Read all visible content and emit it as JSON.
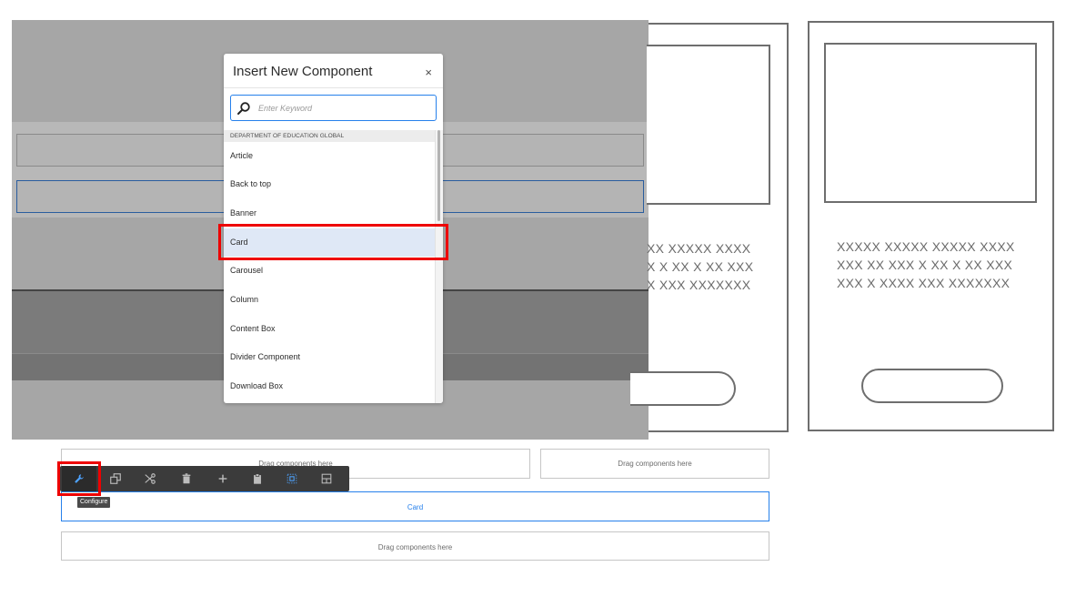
{
  "modal": {
    "title": "Insert New Component",
    "close_glyph": "×",
    "search_placeholder": "Enter Keyword",
    "group_header": "DEPARTMENT OF EDUCATION GLOBAL",
    "items": [
      "Article",
      "Back to top",
      "Banner",
      "Card",
      "Carousel",
      "Column",
      "Content Box",
      "Divider Component",
      "Download Box"
    ],
    "selected_item": "Card"
  },
  "wireframe": {
    "card_left_text": [
      "XX XXXXX XXXX",
      "X X XX X XX XXX",
      "X XXX XXXXXXX"
    ],
    "card_right_text": [
      "XXXXX XXXXX XXXXX XXXX",
      "XXX XX XXX X XX X XX XXX",
      "XXX X XXXX XXX XXXXXXX"
    ]
  },
  "editor": {
    "drop_top_left": "Drag components here",
    "drop_top_right": "Drag components here",
    "card_label": "Card",
    "drop_bottom": "Drag components here",
    "toolbar": {
      "tooltip": "Configure",
      "icons": [
        "wrench-icon",
        "copy-icon",
        "cut-icon",
        "trash-icon",
        "plus-icon",
        "paste-icon",
        "group-icon",
        "layout-icon"
      ]
    }
  },
  "colors": {
    "accent": "#2680eb",
    "highlight": "#ee0000",
    "toolbar_bg": "#3b3b3b",
    "selected_row": "#dfe8f6"
  }
}
